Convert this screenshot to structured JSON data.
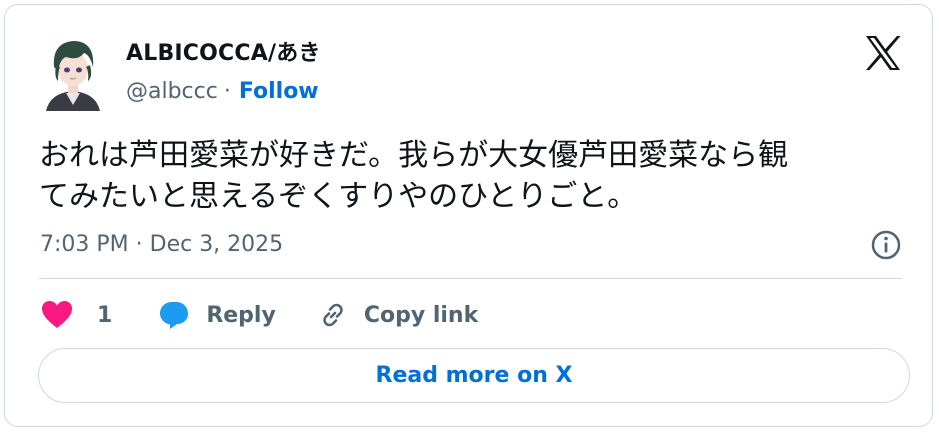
{
  "author": {
    "name": "ALBICOCCA/あき",
    "handle": "@albccc",
    "separator": "·",
    "follow_label": "Follow"
  },
  "tweet": {
    "line1": "おれは芦田愛菜が好きだ。我らが大女優芦田愛菜なら観",
    "line2": "てみたいと思えるぞくすりやのひとりごと。",
    "timestamp": "7:03 PM · Dec 3, 2025"
  },
  "actions": {
    "like_count": "1",
    "reply_label": "Reply",
    "copy_link_label": "Copy link"
  },
  "footer": {
    "read_more_label": "Read more on X"
  },
  "colors": {
    "link_blue": "#006fd6",
    "like_pink": "#f91880",
    "reply_blue": "#1d9bf0",
    "muted": "#536471",
    "border": "#cfd9de"
  },
  "icons": [
    "avatar",
    "x-logo-icon",
    "info-icon",
    "heart-icon",
    "reply-bubble-icon",
    "link-icon"
  ]
}
